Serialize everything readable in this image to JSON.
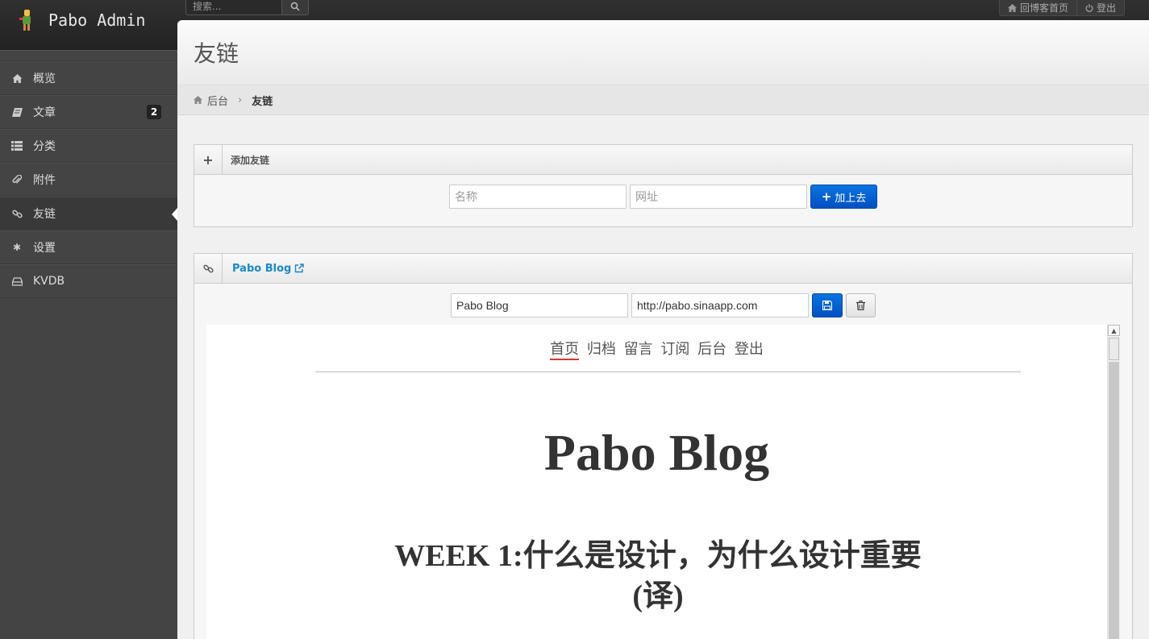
{
  "topbar": {
    "brand": "Pabo Admin",
    "search_placeholder": "搜索...",
    "links": [
      {
        "icon": "home-icon",
        "label": "回博客首页"
      },
      {
        "icon": "power-icon",
        "label": "登出"
      }
    ]
  },
  "sidebar": {
    "items": [
      {
        "icon": "home-icon",
        "label": "概览"
      },
      {
        "icon": "book-icon",
        "label": "文章",
        "badge": "2"
      },
      {
        "icon": "list-icon",
        "label": "分类"
      },
      {
        "icon": "paperclip-icon",
        "label": "附件"
      },
      {
        "icon": "link-icon",
        "label": "友链",
        "active": true
      },
      {
        "icon": "gear-icon",
        "label": "设置"
      },
      {
        "icon": "hdd-icon",
        "label": "KVDB"
      }
    ]
  },
  "page": {
    "title": "友链",
    "breadcrumb": {
      "home": "后台",
      "current": "友链"
    }
  },
  "add_box": {
    "title": "添加友链",
    "name_placeholder": "名称",
    "url_placeholder": "网址",
    "submit_label": "加上去"
  },
  "link_box": {
    "title": "Pabo Blog",
    "name_value": "Pabo Blog",
    "url_value": "http://pabo.sinaapp.com"
  },
  "preview": {
    "nav": [
      "首页",
      "归档",
      "留言",
      "订阅",
      "后台",
      "登出"
    ],
    "site_title": "Pabo Blog",
    "post_title": "WEEK 1:什么是设计，为什么设计重要(译)"
  },
  "colors": {
    "primary": "#0151c4",
    "link": "#1a8ac6",
    "sidebar": "#444444"
  }
}
